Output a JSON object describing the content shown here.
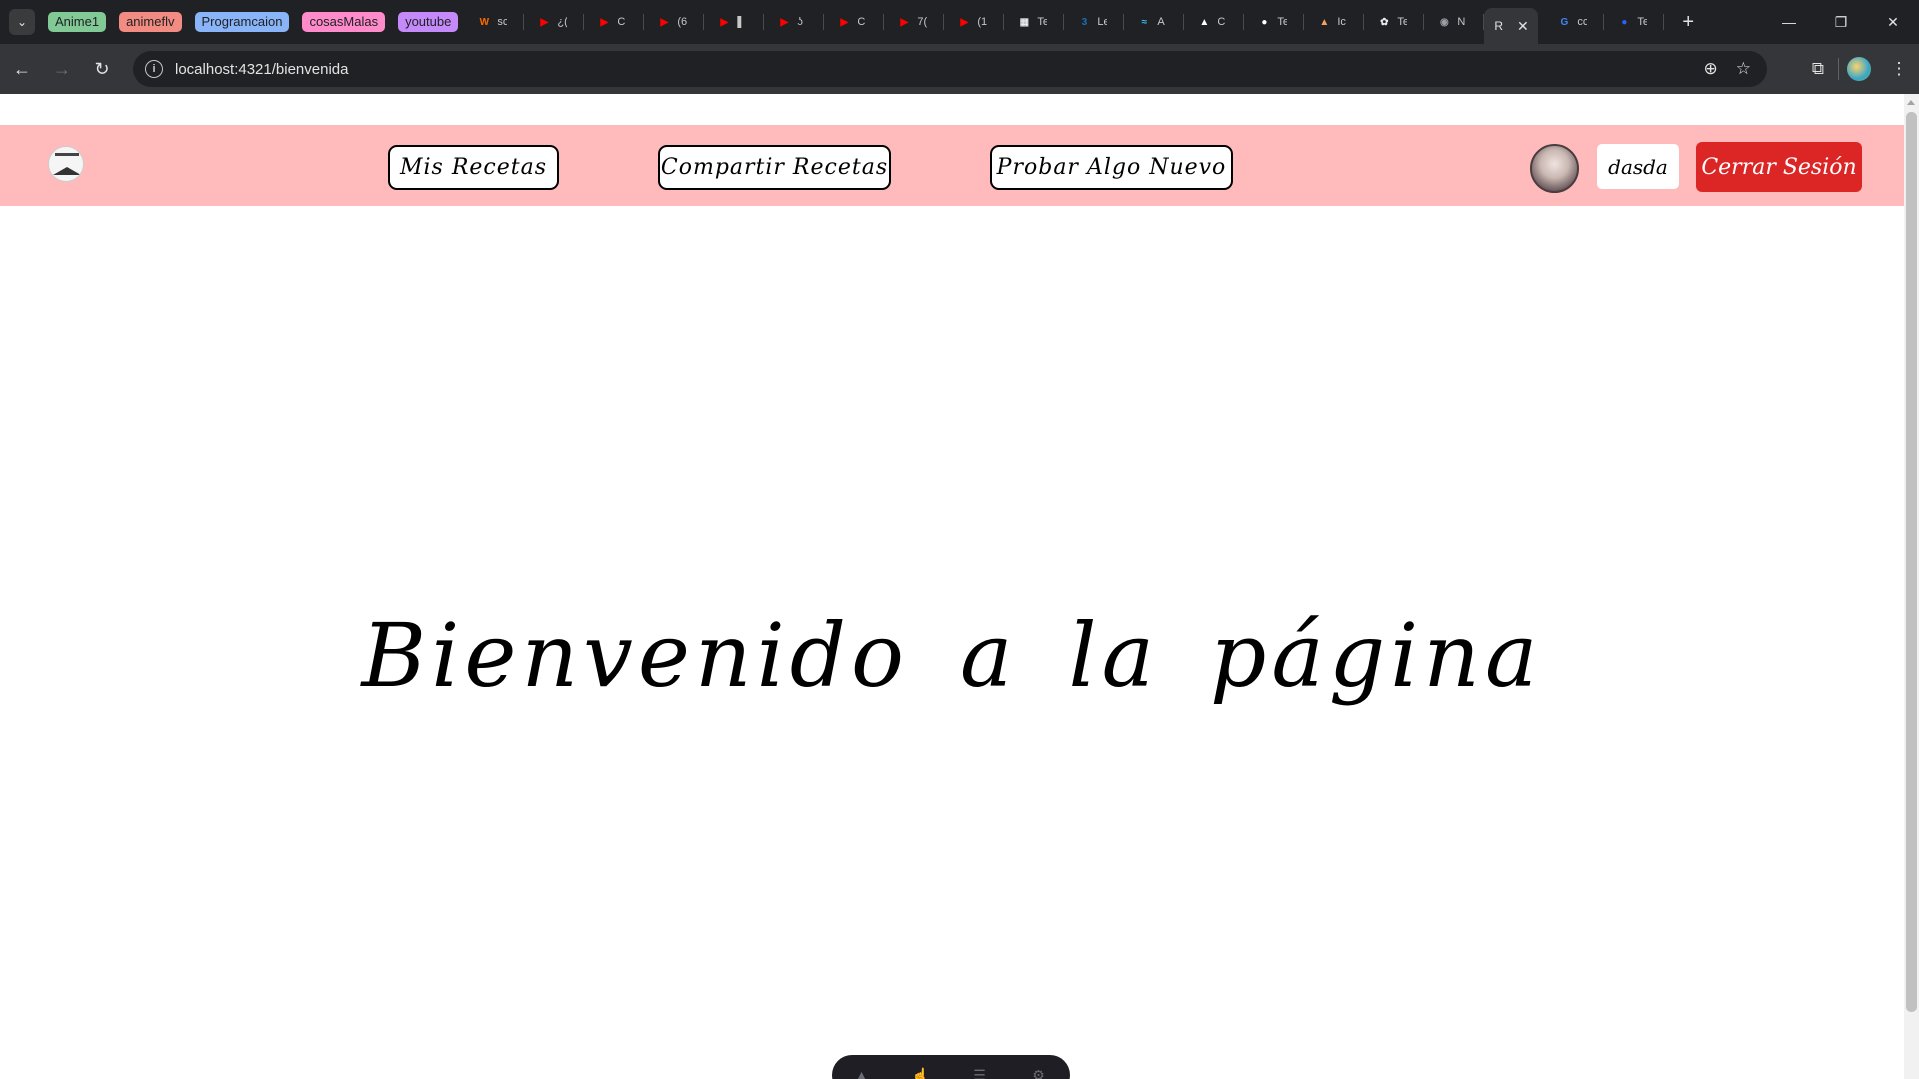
{
  "browser": {
    "tab_groups": [
      {
        "label": "Anime1",
        "color": "#81c995"
      },
      {
        "label": "animeflv",
        "color": "#f28b82"
      },
      {
        "label": "Programcaion",
        "color": "#8ab4f8"
      },
      {
        "label": "cosasMalas",
        "color": "#ff8bcb"
      },
      {
        "label": "youtube",
        "color": "#c58af9"
      }
    ],
    "tabs": [
      {
        "icon": "w-icon",
        "color": "#ff6a00",
        "glyph": "W",
        "text": "sc"
      },
      {
        "icon": "youtube-icon",
        "color": "#ff0000",
        "glyph": "▶",
        "text": "¿("
      },
      {
        "icon": "youtube-icon",
        "color": "#ff0000",
        "glyph": "▶",
        "text": "C"
      },
      {
        "icon": "youtube-icon",
        "color": "#ff0000",
        "glyph": "▶",
        "text": "(6"
      },
      {
        "icon": "youtube-icon",
        "color": "#ff0000",
        "glyph": "▶",
        "text": "▌"
      },
      {
        "icon": "youtube-icon",
        "color": "#ff0000",
        "glyph": "▶",
        "text": "ʖ"
      },
      {
        "icon": "youtube-icon",
        "color": "#ff0000",
        "glyph": "▶",
        "text": "C"
      },
      {
        "icon": "youtube-icon",
        "color": "#ff0000",
        "glyph": "▶",
        "text": "7("
      },
      {
        "icon": "youtube-icon",
        "color": "#ff0000",
        "glyph": "▶",
        "text": "(1"
      },
      {
        "icon": "doc-icon",
        "color": "#e8eaed",
        "glyph": "▦",
        "text": "Te"
      },
      {
        "icon": "css-icon",
        "color": "#1572b6",
        "glyph": "3",
        "text": "Le"
      },
      {
        "icon": "tailwind-icon",
        "color": "#38bdf8",
        "glyph": "≈",
        "text": "A"
      },
      {
        "icon": "astro-icon",
        "color": "#ffffff",
        "glyph": "▲",
        "text": "C"
      },
      {
        "icon": "github-icon",
        "color": "#ffffff",
        "glyph": "●",
        "text": "Te"
      },
      {
        "icon": "mountain-icon",
        "color": "#f4a259",
        "glyph": "▲",
        "text": "Ic"
      },
      {
        "icon": "openai-icon",
        "color": "#e8eaed",
        "glyph": "✿",
        "text": "Te"
      },
      {
        "icon": "chrome-icon",
        "color": "#9aa0a6",
        "glyph": "◉",
        "text": "N"
      }
    ],
    "active_tab": {
      "text": "R",
      "close": "✕"
    },
    "after_tabs": [
      {
        "icon": "google-icon",
        "color": "#4285f4",
        "glyph": "G",
        "text": "cc"
      },
      {
        "icon": "blue-circle-icon",
        "color": "#2962ff",
        "glyph": "●",
        "text": "Te"
      }
    ],
    "url": "localhost:4321/bienvenida"
  },
  "navbar": {
    "links": [
      {
        "label": "Mis Recetas"
      },
      {
        "label": "Compartir Recetas"
      },
      {
        "label": "Probar Algo Nuevo"
      }
    ],
    "username": "dasda",
    "logout_label": "Cerrar Sesión",
    "colors": {
      "bar": "#ffbbbb",
      "logout": "#dc2626"
    }
  },
  "main": {
    "heading": "Bienvenido a la página"
  }
}
